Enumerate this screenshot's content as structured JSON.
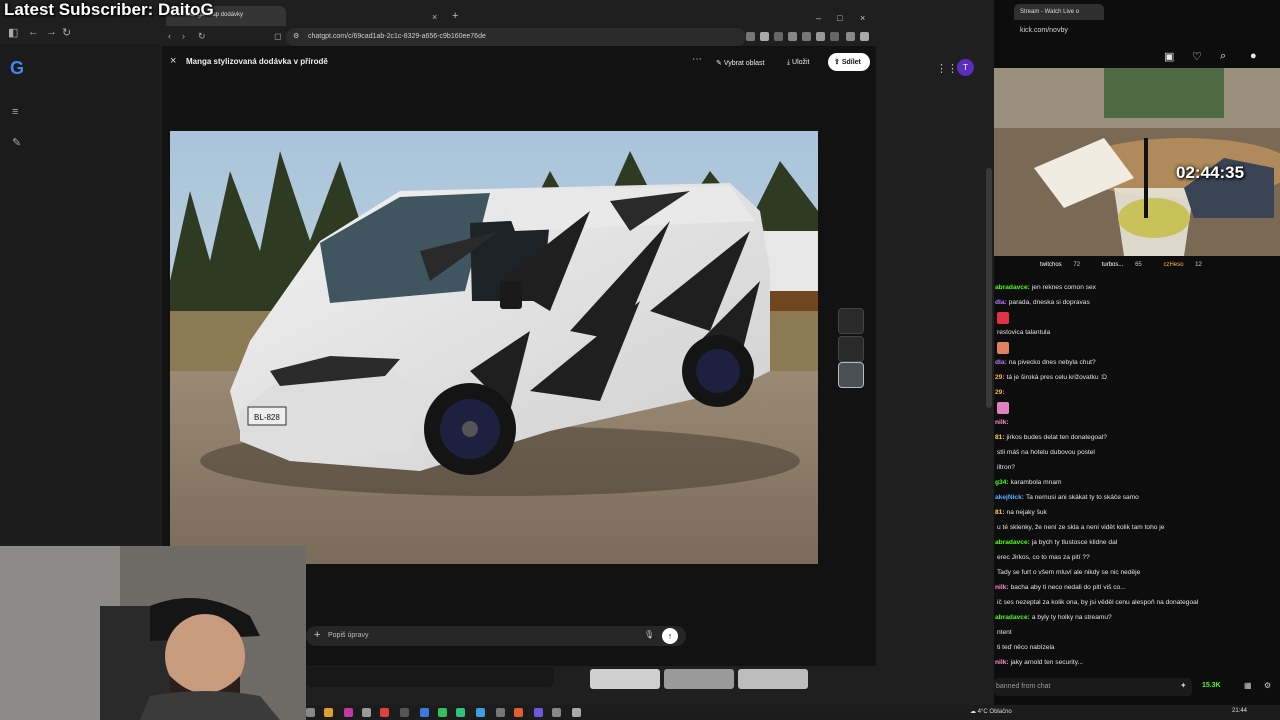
{
  "overlay": {
    "subscriber_banner": "Latest Subscriber: DaitoG"
  },
  "left_browser": {
    "tab_title": "Manga wrap dodávky",
    "url": "chatgpt.com/c/69cad1ab-2c1c-8329-a656-c9b160ee76de",
    "close_tab": "×",
    "new_tab": "+",
    "window_controls": [
      "–",
      "□",
      "×"
    ]
  },
  "background_page": {
    "google_logo": "G",
    "avatar_letter": "T"
  },
  "viewer": {
    "close": "×",
    "title": "Manga stylizovaná dodávka v přírodě",
    "more": "⋯",
    "select_area_label": "Vybrat oblast",
    "save_label": "Uložit",
    "share_label": "Sdílet",
    "prompt_placeholder": "Popiš úpravy",
    "prompt_plus": "+",
    "send_icon": "↑",
    "plate_text": "BL-828"
  },
  "right_browser": {
    "tab_title": "Stream - Watch Live o",
    "url": "kick.com/novby",
    "timer": "02:44:35",
    "gifters": [
      {
        "name": "twitchos",
        "count": "72"
      },
      {
        "name": "turbos...",
        "count": "65"
      },
      {
        "name": "czHeso",
        "count": "12"
      }
    ],
    "chat": [
      {
        "user": "abradavce:",
        "text": "jen reknes comon sex",
        "color": "#53fc18"
      },
      {
        "user": "dla:",
        "text": "parada, dneska si dopravas",
        "color": "#b77cff"
      },
      {
        "user": "",
        "text": "",
        "color": "#e0304a"
      },
      {
        "user": "",
        "text": "restovica talantula",
        "color": "#ff6a6a"
      },
      {
        "user": "",
        "text": "",
        "color": "#e08060"
      },
      {
        "user": "dla:",
        "text": "na pivecko dnes nebyla chut?",
        "color": "#b77cff"
      },
      {
        "user": "29:",
        "text": "tá je široká pres celu križovatku :D",
        "color": "#ffb347"
      },
      {
        "user": "29:",
        "text": "",
        "color": "#ffb347"
      },
      {
        "user": "",
        "text": "",
        "color": "#e080c0"
      },
      {
        "user": "nilk:",
        "text": "",
        "color": "#ff8fd0"
      },
      {
        "user": "81:",
        "text": "jirkos budes delat ten donategoal?",
        "color": "#ffcf5a"
      },
      {
        "user": "",
        "text": "stli máš na hotelu dubovou postel",
        "color": "#e0e0e0"
      },
      {
        "user": "",
        "text": "iltron?",
        "color": "#e0e0e0"
      },
      {
        "user": "g34:",
        "text": "karambola mnam",
        "color": "#53fc18"
      },
      {
        "user": "akejNick:",
        "text": "Ta nemusi ani skákat ty to skáče samo",
        "color": "#5ab0ff"
      },
      {
        "user": "81:",
        "text": "na nejaky šuk",
        "color": "#ffcf5a"
      },
      {
        "user": "",
        "text": "u té sklenky, že není ze skla a není vidět kolik tam toho je",
        "color": "#e0e0e0"
      },
      {
        "user": "abradavce:",
        "text": "ja bych ty tlustosce klidne dal",
        "color": "#53fc18"
      },
      {
        "user": "",
        "text": "erec Jirkos, co to mas za pití ??",
        "color": "#e0e0e0"
      },
      {
        "user": "",
        "text": "Tady se furt o všem mluví ale nikdy se nic neděje",
        "color": "#e0e0e0"
      },
      {
        "user": "nilk:",
        "text": "bacha aby ti neco nedali do pití viš co...",
        "color": "#ff8fd0"
      },
      {
        "user": "",
        "text": "ič ses nezeptal za kolik ona, by jsi věděl cenu alespoň na donategoal",
        "color": "#e0e0e0"
      },
      {
        "user": "abradavce:",
        "text": "a byly ty holky na streamu?",
        "color": "#53fc18"
      },
      {
        "user": "",
        "text": "ntent",
        "color": "#e0e0e0"
      },
      {
        "user": "",
        "text": "ti teď něco nabízela",
        "color": "#e0e0e0"
      },
      {
        "user": "nilk:",
        "text": "jaky arnold ten security...",
        "color": "#ff8fd0"
      }
    ],
    "chat_placeholder": "banned from chat",
    "viewer_count": "15.3K"
  },
  "taskbar": {
    "weather": "4°C Oblačno",
    "time": "21:44"
  },
  "colors": {
    "kick_green": "#53fc18",
    "chatgpt_dark": "#121212"
  }
}
